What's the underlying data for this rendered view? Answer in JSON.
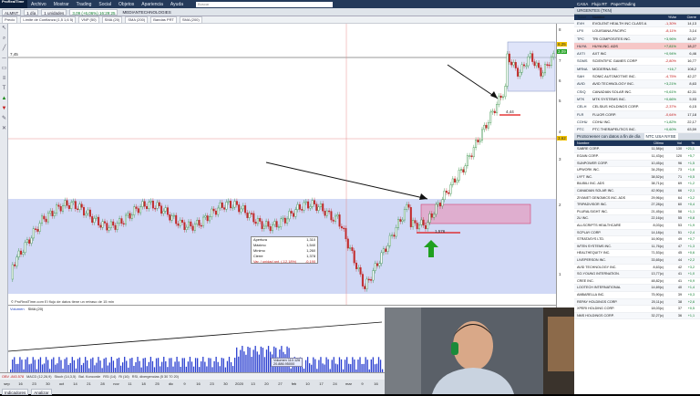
{
  "menu": {
    "logo": "ProRealTime",
    "items": [
      "Archivo",
      "Mostrar",
      "Trading",
      "Social",
      "Objetos",
      "Apariencia",
      "Ayuda"
    ],
    "search_placeholder": "Buscar"
  },
  "toolbar": {
    "symbol": "ALMNT",
    "timeframe": "1 día",
    "units": "1 unidades",
    "quote": "3,09 (+6,06%) 16:29:25",
    "company": "MEDIANTECHNOLOGIES"
  },
  "indicators_strip": [
    "Precio",
    "Límite de Confianza (1,5 1,6 5)",
    "VNP (50)",
    "SMA (20)",
    "SMA (200)",
    "Bandas PRT",
    "SMA (200)"
  ],
  "price_axis": {
    "labels": [
      "8",
      "7",
      "6",
      "5",
      "4",
      "3",
      "2",
      "1"
    ],
    "current_price": "3,09",
    "tag_high": "8,25",
    "tag_mid": "3,62",
    "line_label": "7,45"
  },
  "annotations": {
    "support_label": "1,576",
    "resistance_label": "4,44"
  },
  "info_box": {
    "rows": [
      {
        "k": "Apertura",
        "v": "1,310"
      },
      {
        "k": "Máximo",
        "v": "1,540"
      },
      {
        "k": "Mínimo",
        "v": "1,260"
      },
      {
        "k": "Cierre",
        "v": "1,378"
      },
      {
        "k": "Var. / unidad ant. (-12,18%)",
        "v": "-0,190"
      }
    ]
  },
  "disclaimer": "© ProRealTime.com  El flujo de datos tiene un retraso de 15 min",
  "volume_panel": {
    "title": "Volumen",
    "sma": "SMA (20)",
    "vol_tooltip": "Volumen    110.126",
    "vol_tooltip2": "20.886.95000"
  },
  "indicator_legend": [
    "OBV -843.578",
    "MACD (12,26,9)",
    "Stoch (14,3,5)",
    "Bal. Koncorde",
    "RSI (14)",
    "Ri (16)",
    "RSI, divergencias (5 30 70 20)"
  ],
  "dates": [
    "sep",
    "16",
    "23",
    "30",
    "oct",
    "14",
    "21",
    "28",
    "nov",
    "11",
    "18",
    "25",
    "dic",
    "9",
    "16",
    "23",
    "30",
    "2020",
    "13",
    "20",
    "27",
    "feb",
    "10",
    "17",
    "24",
    "mar",
    "9",
    "16",
    "23"
  ],
  "bottom_tools": [
    "Indicadores",
    "Analizar"
  ],
  "right_panel": {
    "top_tabs": [
      "CASA",
      "Flujo RT",
      "PaperTrading"
    ],
    "list_title": "URGENTES (TKN)",
    "list_headers": [
      "Ticker",
      "Nombre",
      "%Var",
      "Cierre"
    ],
    "list": [
      {
        "t": "EVH",
        "n": "EVOLENT HEALTH INC CLASS A",
        "v": "-1,30%",
        "c": "14,13",
        "neg": true
      },
      {
        "t": "LPX",
        "n": "LOUISIANA-PACIFIC",
        "v": "-8,11%",
        "c": "3,14",
        "neg": true
      },
      {
        "t": "TPC",
        "n": "TRI COMPOSITES INC.",
        "v": "+3,96%",
        "c": "46,37",
        "neg": false
      },
      {
        "t": "HUYA",
        "n": "HUYA INC. ADS",
        "v": "+7,81%",
        "c": "18,27",
        "neg": false
      },
      {
        "t": "AXTI",
        "n": "AXT INC",
        "v": "+0,94%",
        "c": "6,46",
        "neg": false
      },
      {
        "t": "SGMS",
        "n": "SCIENTIFIC GAMES CORP",
        "v": "-2,80%",
        "c": "16,77",
        "neg": true
      },
      {
        "t": "MRNA",
        "n": "MODERNA INC.",
        "v": "+16,7",
        "c": "108,2",
        "neg": false
      },
      {
        "t": "SAH",
        "n": "SONIC AUTOMOTIVE INC.",
        "v": "-4,75%",
        "c": "42,27",
        "neg": true
      },
      {
        "t": "AVID",
        "n": "AVID TECHNOLOGY INC.",
        "v": "+3,21%",
        "c": "8,63",
        "neg": false
      },
      {
        "t": "CSIQ",
        "n": "CANADIAN SOLAR INC.",
        "v": "+0,61%",
        "c": "42,31",
        "neg": false
      },
      {
        "t": "MTK",
        "n": "MTK SYSTEMS INC.",
        "v": "+0,66%",
        "c": "5,93",
        "neg": false
      },
      {
        "t": "CELH",
        "n": "CELSIUS HOLDINGS CORP.",
        "v": "-2,37%",
        "c": "6,15",
        "neg": true
      },
      {
        "t": "FLR",
        "n": "FLUOR CORP.",
        "v": "-0,64%",
        "c": "17,18",
        "neg": true
      },
      {
        "t": "COHU",
        "n": "COHU INC.",
        "v": "+1,82%",
        "c": "22,17",
        "neg": false
      },
      {
        "t": "PTC",
        "n": "PTC THERAPEUTICS INC.",
        "v": "+0,60%",
        "c": "63,59",
        "neg": false
      }
    ],
    "screener_title": "ProScreener con datos a fin de día",
    "screener_filter": "NTC USA NYSE",
    "screener_headers": [
      "Nombre",
      "Último",
      "Vol",
      "%"
    ],
    "screener": [
      {
        "n": "SABRE CORP.",
        "p": "11,58(c)",
        "v": "130",
        "c": "+21,1"
      },
      {
        "n": "EGAIN CORP.",
        "p": "11,43(c)",
        "v": "120",
        "c": "+5,7"
      },
      {
        "n": "SUNPOWER CORP.",
        "p": "10,45(c)",
        "v": "96",
        "c": "+1,5"
      },
      {
        "n": "UPWORK INC.",
        "p": "34,25(c)",
        "v": "73",
        "c": "+1,6"
      },
      {
        "n": "LYFT INC.",
        "p": "38,52(c)",
        "v": "71",
        "c": "+0,5"
      },
      {
        "n": "BILIBILI INC. ADS",
        "p": "38,71(c)",
        "v": "69",
        "c": "+1,2"
      },
      {
        "n": "CANADIAN SOLAR INC.",
        "p": "42,90(c)",
        "v": "66",
        "c": "+2,1"
      },
      {
        "n": "ZIYANET GENOMICS INC. ADS",
        "p": "29,96(c)",
        "v": "64",
        "c": "+3,2"
      },
      {
        "n": "TRIPADVISOR INC.",
        "p": "27,28(c)",
        "v": "60",
        "c": "+0,4"
      },
      {
        "n": "PLURALSIGHT INC.",
        "p": "21,45(c)",
        "v": "58",
        "c": "+1,1"
      },
      {
        "n": "2U INC.",
        "p": "22,16(c)",
        "v": "55",
        "c": "+0,8"
      },
      {
        "n": "ALLSCRIPTS HEALTHCARE",
        "p": "8,03(c)",
        "v": "53",
        "c": "+1,9"
      },
      {
        "n": "SCPLAY CORP.",
        "p": "14,18(c)",
        "v": "51",
        "c": "+2,4"
      },
      {
        "n": "STRATASYS LTD.",
        "p": "16,90(c)",
        "v": "49",
        "c": "+0,7"
      },
      {
        "n": "WTEN SYSTEMS INC.",
        "p": "11,76(c)",
        "v": "47",
        "c": "+1,3"
      },
      {
        "n": "HEALTHEQUITY INC.",
        "p": "71,53(c)",
        "v": "45",
        "c": "+0,6"
      },
      {
        "n": "LIVEPERSON INC.",
        "p": "33,65(c)",
        "v": "44",
        "c": "+2,2"
      },
      {
        "n": "AVID TECHNOLOGY INC.",
        "p": "8,63(c)",
        "v": "42",
        "c": "+3,2"
      },
      {
        "n": "SO-YOUNG INTERNATION.",
        "p": "13,77(c)",
        "v": "41",
        "c": "+1,0"
      },
      {
        "n": "CREE INC.",
        "p": "48,82(c)",
        "v": "41",
        "c": "+0,9"
      },
      {
        "n": "LOOTECH INTERNATIONAL",
        "p": "14,69(c)",
        "v": "40",
        "c": "+1,4"
      },
      {
        "n": "AMBARELLA INC.",
        "p": "75,90(c)",
        "v": "39",
        "c": "+0,3"
      },
      {
        "n": "REPAY HOLDINGS CORP.",
        "p": "20,11(c)",
        "v": "38",
        "c": "+2,6"
      },
      {
        "n": "XPERI HOLDING CORP.",
        "p": "18,03(c)",
        "v": "37",
        "c": "+0,5"
      },
      {
        "n": "NMS HOLDINGS CORP.",
        "p": "32,27(c)",
        "v": "36",
        "c": "+1,1"
      }
    ]
  },
  "colors": {
    "support_zone": "#c9d2f5",
    "candle_up": "#2e8b3e",
    "candle_down": "#c22a2a",
    "accent_red": "#e01010",
    "arrow_green": "#1fa01f"
  }
}
